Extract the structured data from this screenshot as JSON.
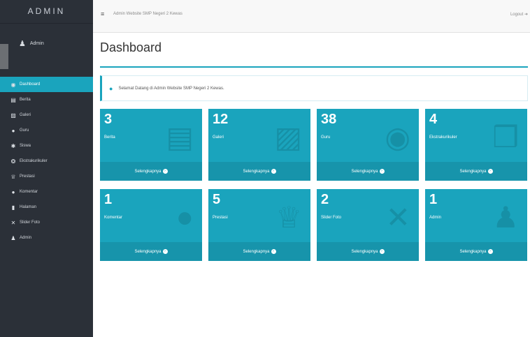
{
  "sidebar": {
    "brand": "ADMIN",
    "user": "Admin",
    "items": [
      {
        "label": "Dashboard",
        "icon": "dashboard-icon",
        "glyph": "◉",
        "active": true
      },
      {
        "label": "Berita",
        "icon": "newspaper-icon",
        "glyph": "▤",
        "active": false
      },
      {
        "label": "Galeri",
        "icon": "image-icon",
        "glyph": "▨",
        "active": false
      },
      {
        "label": "Guru",
        "icon": "user-circle-icon",
        "glyph": "●",
        "active": false
      },
      {
        "label": "Siswa",
        "icon": "users-icon",
        "glyph": "✱",
        "active": false
      },
      {
        "label": "Ekstrakurikuler",
        "icon": "cube-icon",
        "glyph": "❂",
        "active": false
      },
      {
        "label": "Prestasi",
        "icon": "trophy-icon",
        "glyph": "♕",
        "active": false
      },
      {
        "label": "Komentar",
        "icon": "comment-icon",
        "glyph": "●",
        "active": false
      },
      {
        "label": "Halaman",
        "icon": "file-icon",
        "glyph": "▮",
        "active": false
      },
      {
        "label": "Slider Foto",
        "icon": "shuffle-icon",
        "glyph": "✕",
        "active": false
      },
      {
        "label": "Admin",
        "icon": "user-secret-icon",
        "glyph": "♟",
        "active": false
      }
    ]
  },
  "topbar": {
    "site_title": "Admin Website SMP Negeri 2 Kewas",
    "logout": "Logout"
  },
  "page": {
    "title": "Dashboard",
    "alert": "Selamat Datang di Admin Website SMP Negeri 2 Kewas."
  },
  "cards": [
    {
      "value": "3",
      "label": "Berita",
      "more": "Selengkapnya",
      "icon": "newspaper-icon",
      "glyph": "▤"
    },
    {
      "value": "12",
      "label": "Galeri",
      "more": "Selengkapnya",
      "icon": "image-icon",
      "glyph": "▨"
    },
    {
      "value": "38",
      "label": "Guru",
      "more": "Selengkapnya",
      "icon": "user-circle-icon",
      "glyph": "◉"
    },
    {
      "value": "4",
      "label": "Ekstrakurikuler",
      "more": "Selengkapnya",
      "icon": "cube-icon",
      "glyph": "❒"
    },
    {
      "value": "1",
      "label": "Komentar",
      "more": "Selengkapnya",
      "icon": "comment-icon",
      "glyph": "●"
    },
    {
      "value": "5",
      "label": "Prestasi",
      "more": "Selengkapnya",
      "icon": "trophy-icon",
      "glyph": "♕"
    },
    {
      "value": "2",
      "label": "Slider Foto",
      "more": "Selengkapnya",
      "icon": "shuffle-icon",
      "glyph": "✕"
    },
    {
      "value": "1",
      "label": "Admin",
      "more": "Selengkapnya",
      "icon": "user-secret-icon",
      "glyph": "♟"
    }
  ],
  "colors": {
    "accent": "#1aa4bd",
    "accent_dark": "#1794ab",
    "sidebar": "#2b3038"
  }
}
